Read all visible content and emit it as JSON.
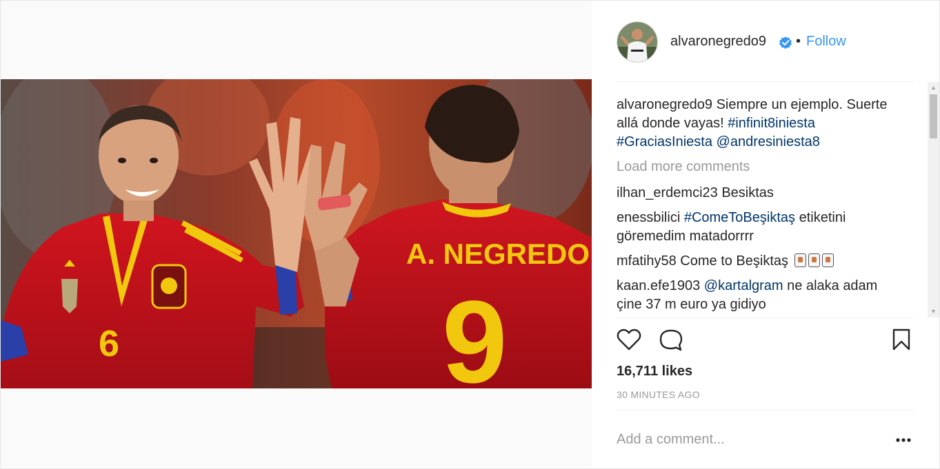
{
  "post": {
    "username": "alvaronegredo9",
    "separator": "•",
    "follow_label": "Follow",
    "caption": {
      "username": "alvaronegredo9",
      "text": "Siempre un ejemplo. Suerte allá donde vayas!",
      "hashtags": [
        "#infinit8iniesta",
        "#GraciasIniesta"
      ],
      "mention": "@andresiniesta8"
    },
    "load_more": "Load more comments",
    "comments": [
      {
        "user": "ilhan_erdemci23",
        "text": "Besiktas"
      },
      {
        "user": "enessbilici",
        "tag": "#ComeToBeşiktaş",
        "text": "etiketini göremedim matadorrrr"
      },
      {
        "user": "mfatihy58",
        "text": "Come to Beşiktaş"
      },
      {
        "user": "kaan.efe1903",
        "mention": "@kartalgram",
        "text": "ne alaka adam çine 37 m euro ya gidiyo"
      }
    ],
    "likes": "16,711 likes",
    "timestamp": "30 MINUTES AGO",
    "comment_placeholder": "Add a comment...",
    "photo_text": {
      "player_name": "A. NEGREDO",
      "number_right": "9",
      "number_left": "6"
    }
  },
  "colors": {
    "link": "#003569",
    "follow": "#3897f0",
    "verified": "#3897f0",
    "muted": "#999999",
    "jersey_red": "#c1121f",
    "jersey_yellow": "#f5d10a"
  },
  "icons": [
    "verified-badge-icon",
    "heart-icon",
    "comment-icon",
    "bookmark-icon",
    "more-options-icon",
    "user-tag-icon"
  ]
}
